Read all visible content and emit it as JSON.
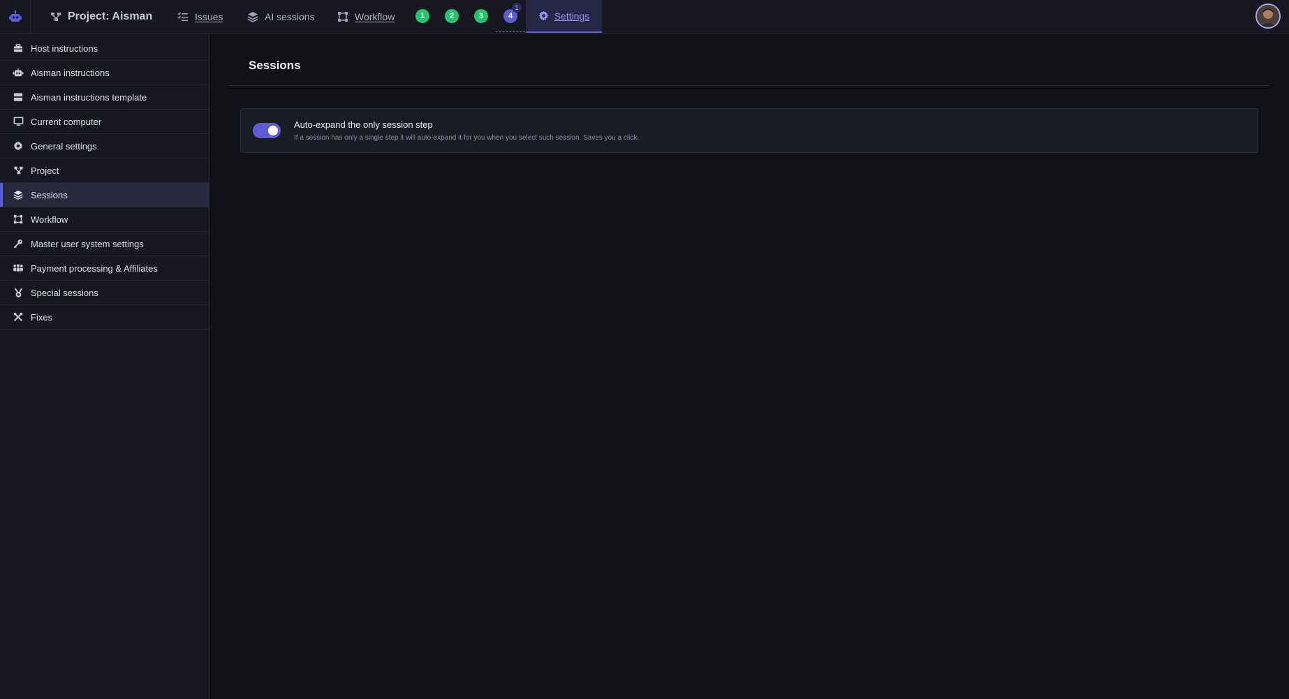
{
  "header": {
    "project_label": "Project: Aisman",
    "nav": [
      {
        "label": "Issues",
        "icon": "list-check-icon"
      },
      {
        "label": "AI sessions",
        "icon": "layers-icon"
      },
      {
        "label": "Workflow",
        "icon": "workflow-icon"
      }
    ],
    "session_badges": [
      "1",
      "2",
      "3",
      "4"
    ],
    "badge4_count": "1",
    "settings_label": "Settings",
    "accent_color": "#5b5cd6",
    "badge_color": "#21c56a"
  },
  "sidebar": {
    "items": [
      {
        "label": "Host instructions",
        "icon": "toolbox-icon"
      },
      {
        "label": "Aisman instructions",
        "icon": "robot-icon"
      },
      {
        "label": "Aisman instructions template",
        "icon": "server-icon"
      },
      {
        "label": "Current computer",
        "icon": "monitor-icon"
      },
      {
        "label": "General settings",
        "icon": "gear-icon"
      },
      {
        "label": "Project",
        "icon": "project-tree-icon"
      },
      {
        "label": "Sessions",
        "icon": "layers-icon",
        "active": true
      },
      {
        "label": "Workflow",
        "icon": "workflow-icon"
      },
      {
        "label": "Master user system settings",
        "icon": "key-icon"
      },
      {
        "label": "Payment processing & Affiliates",
        "icon": "users-icon"
      },
      {
        "label": "Special sessions",
        "icon": "medal-icon"
      },
      {
        "label": "Fixes",
        "icon": "tools-icon"
      }
    ]
  },
  "main": {
    "title": "Sessions",
    "settings": [
      {
        "title": "Auto-expand the only session step",
        "description": "If a session has only a single step it will auto-expand it for you when you select such session. Saves you a click.",
        "enabled": true
      }
    ]
  }
}
